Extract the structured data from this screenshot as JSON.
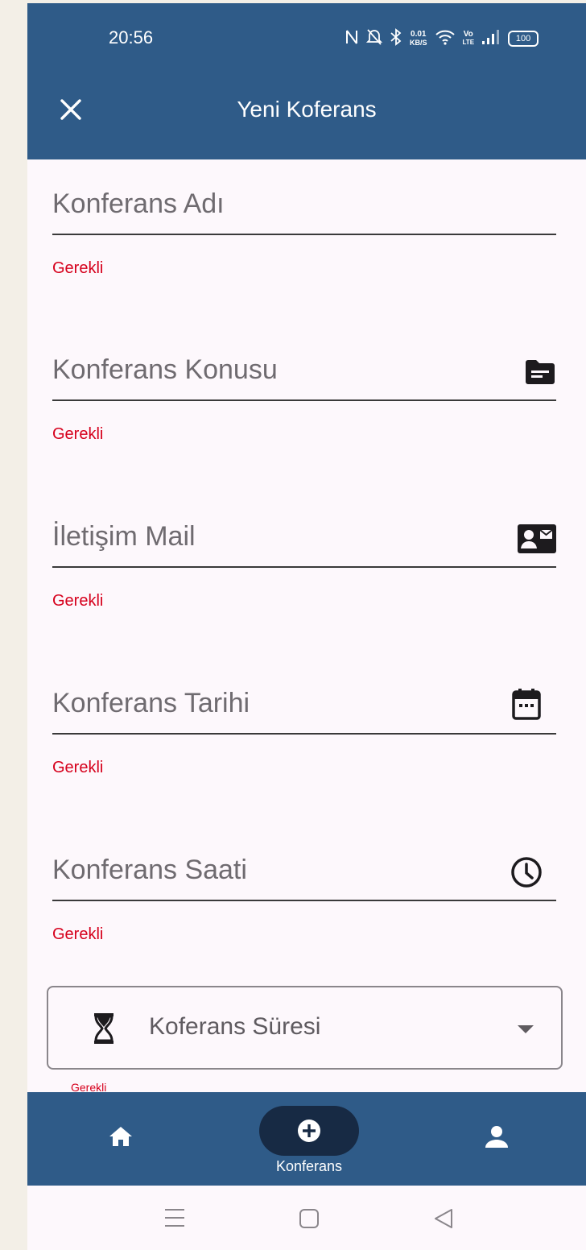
{
  "status_bar": {
    "time": "20:56",
    "speed_value": "0.01",
    "speed_unit": "KB/S",
    "volte_top": "Vo",
    "volte_bottom": "LTE",
    "battery": "100",
    "icons": [
      "nfc-icon",
      "bell-off-icon",
      "bluetooth-icon",
      "wifi-icon",
      "signal-icon",
      "battery-icon"
    ]
  },
  "app_bar": {
    "title": "Yeni Koferans",
    "close_icon": "close-icon"
  },
  "form": {
    "fields": [
      {
        "placeholder": "Konferans Adı",
        "error": "Gerekli",
        "icon": null
      },
      {
        "placeholder": "Konferans Konusu",
        "error": "Gerekli",
        "icon": "topic-folder-icon"
      },
      {
        "placeholder": "İletişim Mail",
        "error": "Gerekli",
        "icon": "contact-mail-icon"
      },
      {
        "placeholder": "Konferans Tarihi",
        "error": "Gerekli",
        "icon": "calendar-icon"
      },
      {
        "placeholder": "Konferans Saati",
        "error": "Gerekli",
        "icon": "clock-icon"
      }
    ],
    "duration_dropdown": {
      "placeholder": "Koferans Süresi",
      "icon": "hourglass-icon",
      "error_partial": "Gerekli"
    }
  },
  "bottom_nav": {
    "items": [
      {
        "icon": "home-icon",
        "label": ""
      },
      {
        "icon": "add-circle-icon",
        "label": "Konferans",
        "active": true
      },
      {
        "icon": "person-icon",
        "label": ""
      }
    ]
  },
  "colors": {
    "primary": "#2f5b88",
    "active_pill": "#172a44",
    "error": "#d6001c",
    "background": "#fdf8fc"
  }
}
